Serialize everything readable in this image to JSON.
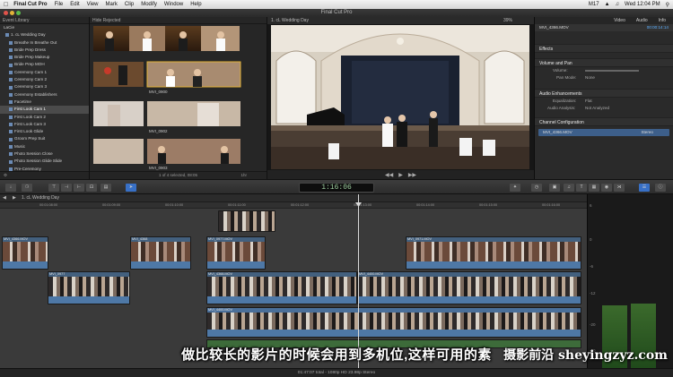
{
  "menubar": {
    "app": "Final Cut Pro",
    "items": [
      "File",
      "Edit",
      "View",
      "Mark",
      "Clip",
      "Modify",
      "Window",
      "Help"
    ],
    "status": "M17",
    "clock": "Wed 12:04 PM"
  },
  "window_title": "Final Cut Pro",
  "library": {
    "header": "Event Library",
    "root": "LaCie",
    "project": "1. cL Wedding Day",
    "events": [
      "Breathe In Breathe Out",
      "Bride Prep Dress",
      "Bride Prep Makeup",
      "Bride Prep MOH",
      "Ceremony Cam 1",
      "Ceremony Cam 2",
      "Ceremony Cam 3",
      "Ceremony Establishers",
      "Facetime",
      "First Look Cam 1",
      "First Look Cam 2",
      "First Look Cam 3",
      "First Look Glide",
      "Groom Prep Suit",
      "Music",
      "Photo Session Close",
      "Photo Session Glide Slide",
      "Pre-Ceremony"
    ],
    "selected_index": 9
  },
  "browser": {
    "header": "Hide Rejected",
    "labels": [
      "MVI_0900",
      "MVI_0902",
      "MVI_0903",
      "MVI_0904"
    ],
    "footer": "1 of 4 selected, 08:05",
    "zoom": "1hr"
  },
  "viewer": {
    "header": "1. cL Wedding Day",
    "zoom": "39%",
    "view": "View"
  },
  "inspector": {
    "tabs": [
      "Video",
      "Audio",
      "Info"
    ],
    "clip": "MVI_4366.MOV",
    "timecode": "00:00:14:14",
    "sections": [
      "Effects",
      "Volume and Pan",
      "Audio Enhancements",
      "Channel Configuration"
    ],
    "volume_label": "Volume:",
    "panmode_label": "Pan Mode:",
    "panmode_value": "None",
    "eq_label": "Equalization:",
    "eq_value": "Flat",
    "analysis_label": "Audio Analysis:",
    "analysis_value": "Not Analyzed",
    "channel_clip": "MVI_4366.MOV",
    "channel_mode": "Stereo"
  },
  "toolbar": {
    "timecode": "1:16:06"
  },
  "timeline": {
    "header": "1. cL Wedding Day",
    "ruler": [
      "00:01:08:00",
      "00:01:09:00",
      "00:01:10:00",
      "00:01:11:00",
      "00:01:12:00",
      "00:01:13:00",
      "00:01:14:00",
      "00:01:15:00",
      "00:01:16:00",
      "00:01:17:00"
    ],
    "clips": [
      "MVI_4366.MOV",
      "MVI_4368",
      "MVI_0977.MOV",
      "MVI_0971.MOV",
      "MVI_0977",
      "MVI_4368.MOV",
      "MVI_4400.MOV",
      "MVI_4400.MOV"
    ]
  },
  "meters": {
    "labels": [
      "6",
      "0",
      "-6",
      "-12",
      "-20",
      "-30"
    ]
  },
  "status": "01:47:07 total - 1080p HD 23.98p Stereo",
  "overlay": {
    "subtitle": "做比较长的影片的时候会用到多机位,这样可用的素",
    "watermark": "摄影前沿 sheyingzyz.com"
  }
}
